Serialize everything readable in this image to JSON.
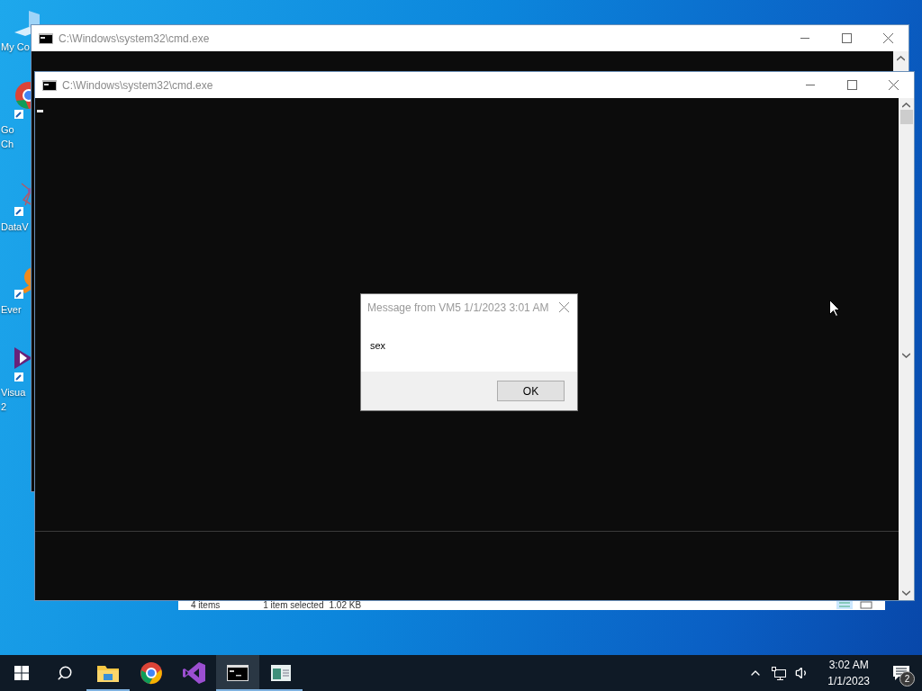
{
  "desktop_icons": [
    {
      "kind": "computer",
      "label": [
        "My Co"
      ]
    },
    {
      "kind": "chrome",
      "label": [
        "Go",
        "Ch"
      ]
    },
    {
      "kind": "network",
      "label": [
        "DataV"
      ]
    },
    {
      "kind": "orange",
      "label": [
        "Ever"
      ]
    },
    {
      "kind": "studio",
      "label": [
        "Visua",
        "2"
      ]
    }
  ],
  "explorer_status": {
    "item_count": "4 items",
    "selection": "1 item selected",
    "size": "1.02 KB"
  },
  "windows": [
    {
      "title": "C:\\Windows\\system32\\cmd.exe"
    },
    {
      "title": "C:\\Windows\\system32\\cmd.exe"
    }
  ],
  "dialog": {
    "title": "Message from VM5 1/1/2023 3:01 AM",
    "message": "sex",
    "button": "OK"
  },
  "taskbar": {
    "apps": [
      {
        "kind": "explorer",
        "running": true,
        "selected": false
      },
      {
        "kind": "chrome",
        "running": false,
        "selected": false
      },
      {
        "kind": "studio",
        "running": false,
        "selected": false
      },
      {
        "kind": "console",
        "running": true,
        "selected": true
      },
      {
        "kind": "app",
        "running": true,
        "selected": false
      }
    ],
    "time": "3:02 AM",
    "date": "1/1/2023",
    "notification_count": "2"
  }
}
